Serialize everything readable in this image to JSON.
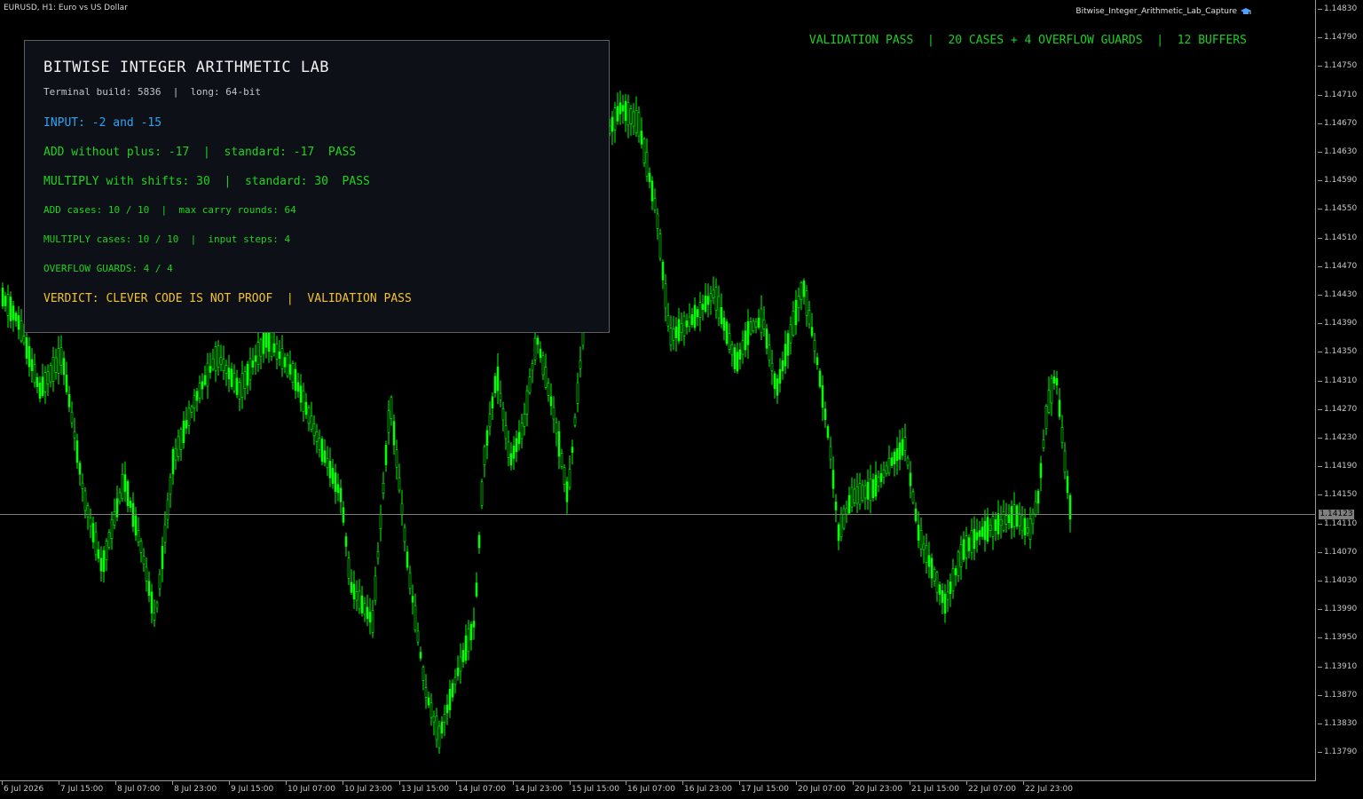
{
  "chart": {
    "symbol_info": "EURUSD, H1:  Euro vs US Dollar",
    "ea_name": "Bitwise_Integer_Arithmetic_Lab_Capture",
    "ea_icon": "graduation-cap-icon",
    "bid_price": "1.14123",
    "price_labels": [
      "1.14830",
      "1.14790",
      "1.14750",
      "1.14710",
      "1.14670",
      "1.14630",
      "1.14590",
      "1.14550",
      "1.14510",
      "1.14470",
      "1.14430",
      "1.14390",
      "1.14350",
      "1.14310",
      "1.14270",
      "1.14230",
      "1.14190",
      "1.14150",
      "1.14110",
      "1.14070",
      "1.14030",
      "1.13990",
      "1.13950",
      "1.13910",
      "1.13870",
      "1.13830",
      "1.13790"
    ],
    "time_labels": [
      "6 Jul 2026",
      "7 Jul 15:00",
      "8 Jul 07:00",
      "8 Jul 23:00",
      "9 Jul 15:00",
      "10 Jul 07:00",
      "10 Jul 23:00",
      "13 Jul 15:00",
      "14 Jul 07:00",
      "14 Jul 23:00",
      "15 Jul 15:00",
      "16 Jul 07:00",
      "16 Jul 23:00",
      "17 Jul 15:00",
      "20 Jul 07:00",
      "20 Jul 23:00",
      "21 Jul 15:00",
      "22 Jul 07:00",
      "22 Jul 23:00"
    ],
    "candle_color": "#00ff00",
    "background": "#000000"
  },
  "status_line": "VALIDATION PASS  |  20 CASES + 4 OVERFLOW GUARDS  |  12 BUFFERS",
  "panel": {
    "title": "BITWISE INTEGER ARITHMETIC LAB",
    "build_line": "Terminal build: 5836  |  long: 64-bit",
    "input_line": "INPUT: -2 and -15",
    "add_line": "ADD without plus: -17  |  standard: -17  PASS",
    "multiply_line": "MULTIPLY with shifts: 30  |  standard: 30  PASS",
    "add_cases_line": "ADD cases: 10 / 10  |  max carry rounds: 64",
    "multiply_cases_line": "MULTIPLY cases: 10 / 10  |  input steps: 4",
    "overflow_line": "OVERFLOW GUARDS: 4 / 4",
    "verdict_line": "VERDICT: CLEVER CODE IS NOT PROOF  |  VALIDATION PASS",
    "colors": {
      "background": "#0d1117",
      "title": "#f0f0f0",
      "info": "#2fa3f0",
      "pass": "#1ed31e",
      "verdict": "#f2c230"
    }
  }
}
